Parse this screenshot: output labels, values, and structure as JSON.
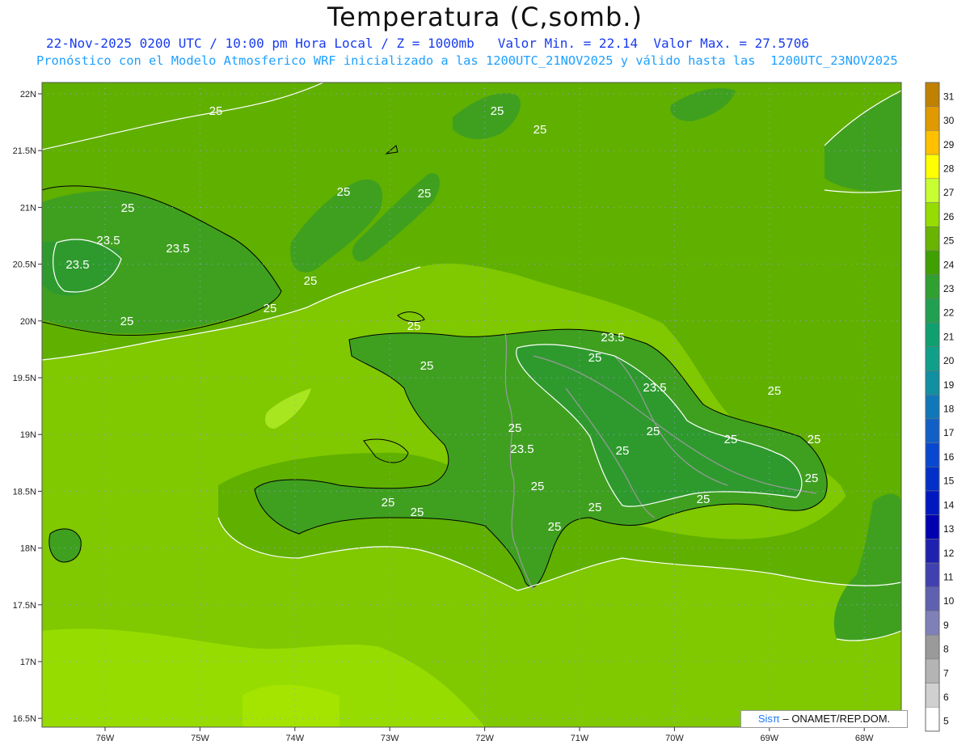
{
  "header": {
    "title": "Temperatura (C,somb.)",
    "subtitle_line1": "22-Nov-2025 0200 UTC / 10:00 pm Hora Local / Z = 1000mb   Valor Min. = 22.14  Valor Max. = 27.5706",
    "subtitle_line2": "Pronóstico con el Modelo Atmosferico WRF inicializado a las 1200UTC_21NOV2025 y válido hasta las  1200UTC_23NOV2025"
  },
  "map": {
    "lat_labels": [
      "22N",
      "21.5N",
      "21N",
      "20.5N",
      "20N",
      "19.5N",
      "19N",
      "18.5N",
      "18N",
      "17.5N",
      "17N",
      "16.5N"
    ],
    "lon_labels": [
      "76W",
      "75W",
      "74W",
      "73W",
      "72W",
      "71W",
      "70W",
      "69W",
      "68W"
    ],
    "contour_labels": [
      "25",
      "25",
      "25",
      "25",
      "25",
      "25",
      "23.5",
      "23.5",
      "23.5",
      "25",
      "25",
      "25",
      "25",
      "25",
      "23.5",
      "25",
      "23.5",
      "25",
      "25",
      "25",
      "25",
      "23.5",
      "25",
      "25",
      "25",
      "25",
      "25",
      "25",
      "25",
      "25",
      "25"
    ],
    "colors": {
      "ocean_warm": "#80c800",
      "ocean_mid": "#60b000",
      "land_cool": "#3fa020",
      "coast": "#000000",
      "border": "#9a9a9a"
    }
  },
  "colorbar": {
    "levels": [
      "31",
      "30",
      "29",
      "28",
      "27",
      "26",
      "25",
      "24",
      "23",
      "22",
      "21",
      "20",
      "19",
      "18",
      "17",
      "16",
      "15",
      "14",
      "13",
      "12",
      "11",
      "10",
      "9",
      "8",
      "7",
      "6",
      "5"
    ],
    "colors": [
      "#c08000",
      "#e09a00",
      "#ffc000",
      "#ffff00",
      "#c8ff30",
      "#96dc00",
      "#68b400",
      "#40a000",
      "#30a030",
      "#20a050",
      "#10a070",
      "#10a08a",
      "#1090a0",
      "#1078b8",
      "#1060c8",
      "#0848d0",
      "#0030c8",
      "#0018c0",
      "#0000b0",
      "#2020b0",
      "#4040b0",
      "#6060b0",
      "#8080b8",
      "#9a9a9a",
      "#b4b4b4",
      "#d0d0d0",
      "#ffffff"
    ]
  },
  "credit": {
    "brand": "Sisπ",
    "text": " – ONAMET/REP.DOM."
  }
}
